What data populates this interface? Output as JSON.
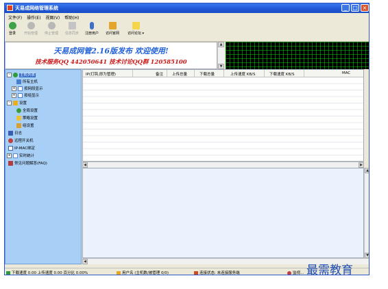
{
  "window": {
    "title": "天易成网络管理系统"
  },
  "menu": [
    "文件(F)",
    "操作(E)",
    "视图(V)",
    "帮助(H)"
  ],
  "toolbar": [
    {
      "label": "登录",
      "icon": "login-icon",
      "enabled": true
    },
    {
      "label": "开始管理",
      "icon": "start-icon",
      "enabled": false
    },
    {
      "label": "停止管理",
      "icon": "stop-icon",
      "enabled": false
    },
    {
      "label": "信息同步",
      "icon": "sync-icon",
      "enabled": false
    },
    {
      "label": "注册用户",
      "icon": "user-icon",
      "enabled": true
    },
    {
      "label": "访问官网",
      "icon": "home-icon",
      "enabled": true
    },
    {
      "label": "访问论坛 ▾",
      "icon": "forum-icon",
      "enabled": true
    }
  ],
  "banner": {
    "line1": "天易成网管2.16版发布 欢迎使用!",
    "line2": "技术服务QQ 442050641 技术讨论QQ群 120585100"
  },
  "tree": [
    {
      "label": "主机列表",
      "level": 0,
      "selected": true,
      "expander": "-",
      "icon": "hosts-icon",
      "color": "#2e9a3a"
    },
    {
      "label": "所有主机",
      "level": 1,
      "icon": "computer-icon",
      "color": "#4a7fd0"
    },
    {
      "label": "按网段显示",
      "level": 1,
      "expander": "+",
      "icon": "segment-icon",
      "color": "#4a7fd0"
    },
    {
      "label": "按组显示",
      "level": 1,
      "expander": "+",
      "icon": "group-icon",
      "color": "#4a7fd0"
    },
    {
      "label": "设置",
      "level": 0,
      "expander": "-",
      "icon": "settings-folder-icon",
      "color": "#e8b020"
    },
    {
      "label": "全局设置",
      "level": 1,
      "icon": "global-settings-icon",
      "color": "#3a9a3a"
    },
    {
      "label": "策略设置",
      "level": 1,
      "icon": "policy-icon",
      "color": "#3a9a3a"
    },
    {
      "label": "组设置",
      "level": 1,
      "icon": "group-settings-icon",
      "color": "#3a9a3a"
    },
    {
      "label": "日志",
      "level": 0,
      "icon": "log-icon",
      "color": "#3a5fb0"
    },
    {
      "label": "远程开关机",
      "level": 0,
      "icon": "power-icon",
      "color": "#c04040"
    },
    {
      "label": "IP-MAC绑定",
      "level": 0,
      "icon": "bind-icon",
      "color": "#3a5fb0"
    },
    {
      "label": "实时统计",
      "level": 0,
      "expander": "+",
      "icon": "stats-icon",
      "color": "#5a8ad0"
    },
    {
      "label": "常见问题解答(FAQ)",
      "level": 0,
      "icon": "faq-icon",
      "color": "#b04040"
    }
  ],
  "table": {
    "columns": [
      "IP(打钩,即为管理)",
      "备注",
      "上传总量",
      "下载总量",
      "上传速度 KB/S",
      "下载速度 KB/S",
      "MAC"
    ]
  },
  "status": {
    "speeds": "下载速度 0.00 上传速度 0.00 百分比 0.00%",
    "user": "用户名 (主机数/被管理 0/0)",
    "conn": "连接状态: 未连接服务端",
    "monitor": "监视..."
  },
  "watermark": "最需教育"
}
